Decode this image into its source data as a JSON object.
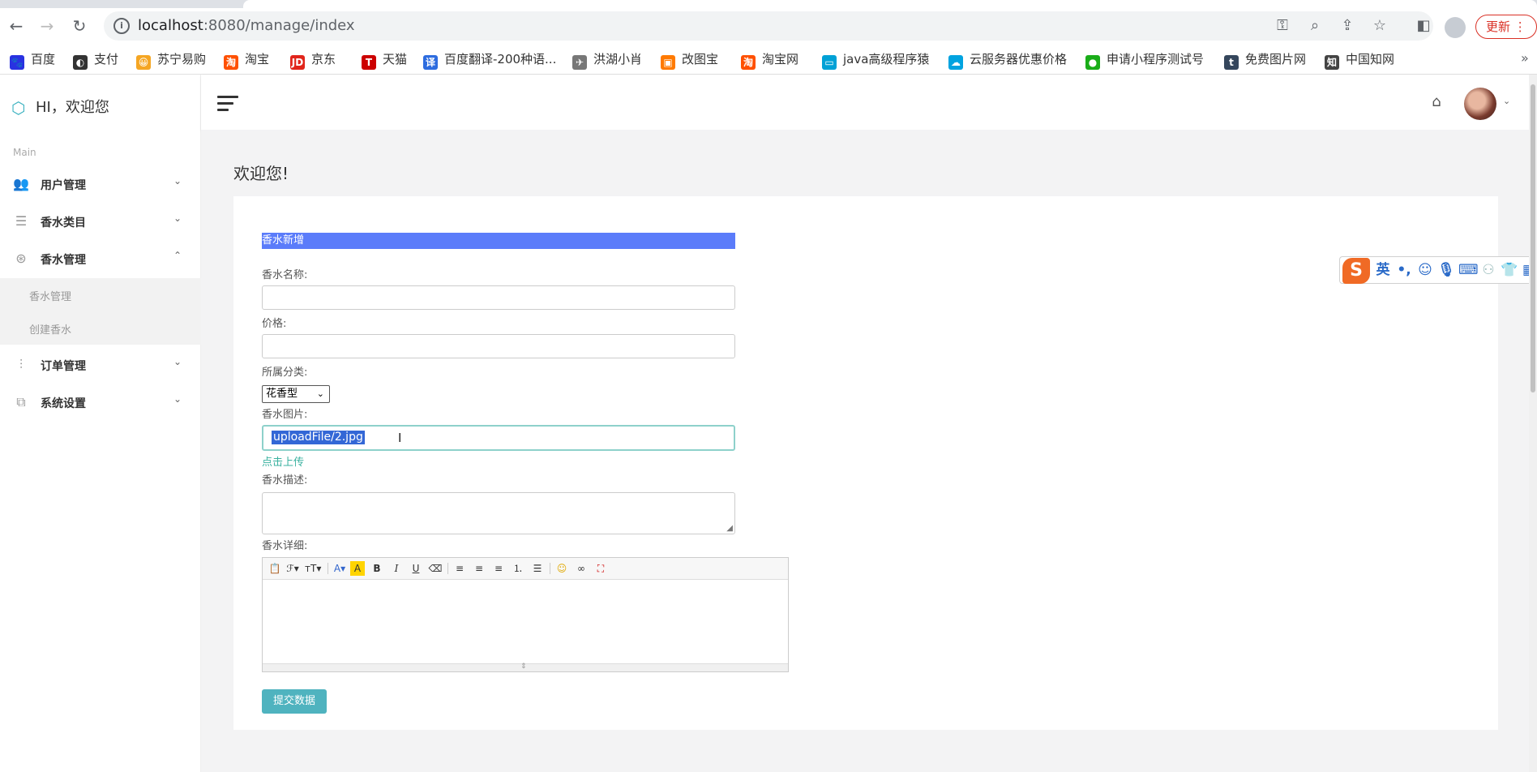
{
  "browser": {
    "url_host": "localhost",
    "url_rest": ":8080/manage/index",
    "update_label": "更新",
    "bookmarks": [
      {
        "label": "百度",
        "color": "#2932e1",
        "glyph": "🐾"
      },
      {
        "label": "支付",
        "color": "#333333",
        "glyph": "◐"
      },
      {
        "label": "苏宁易购",
        "color": "#f5a623",
        "glyph": "😀"
      },
      {
        "label": "淘宝",
        "color": "#ff5000",
        "glyph": "淘"
      },
      {
        "label": "京东",
        "color": "#e1251b",
        "glyph": "JD"
      },
      {
        "label": "天猫",
        "color": "#cc0000",
        "glyph": "T"
      },
      {
        "label": "百度翻译-200种语...",
        "color": "#2d6cdf",
        "glyph": "译"
      },
      {
        "label": "洪湖小肖",
        "color": "#777777",
        "glyph": "✈"
      },
      {
        "label": "改图宝",
        "color": "#ff7a00",
        "glyph": "▣"
      },
      {
        "label": "淘宝网",
        "color": "#ff5000",
        "glyph": "淘"
      },
      {
        "label": "java高级程序猿",
        "color": "#00a1d6",
        "glyph": "▭"
      },
      {
        "label": "云服务器优惠价格",
        "color": "#00a3e0",
        "glyph": "☁"
      },
      {
        "label": "申请小程序测试号",
        "color": "#1aad19",
        "glyph": "●"
      },
      {
        "label": "免费图片网",
        "color": "#35465c",
        "glyph": "t"
      },
      {
        "label": "中国知网",
        "color": "#444444",
        "glyph": "知"
      }
    ]
  },
  "sidebar": {
    "brand": "HI，欢迎您",
    "section_label": "Main",
    "menu": [
      {
        "label": "用户管理",
        "icon": "users-icon"
      },
      {
        "label": "香水类目",
        "icon": "list-icon"
      },
      {
        "label": "香水管理",
        "icon": "aperture-icon"
      },
      {
        "label": "订单管理",
        "icon": "sliders-icon"
      },
      {
        "label": "系统设置",
        "icon": "copy-icon"
      }
    ],
    "submenu": [
      "香水管理",
      "创建香水"
    ]
  },
  "main": {
    "page_title": "欢迎您!",
    "form": {
      "header": "香水新增",
      "name_label": "香水名称:",
      "name_value": "",
      "price_label": "价格:",
      "price_value": "",
      "category_label": "所属分类:",
      "category_selected": "花香型",
      "image_label": "香水图片:",
      "image_value": "uploadFile/2.jpg",
      "upload_link": "点击上传",
      "desc_label": "香水描述:",
      "desc_value": "",
      "detail_label": "香水详细:",
      "submit_label": "提交数据"
    }
  },
  "ime": {
    "mode_label": "英"
  }
}
